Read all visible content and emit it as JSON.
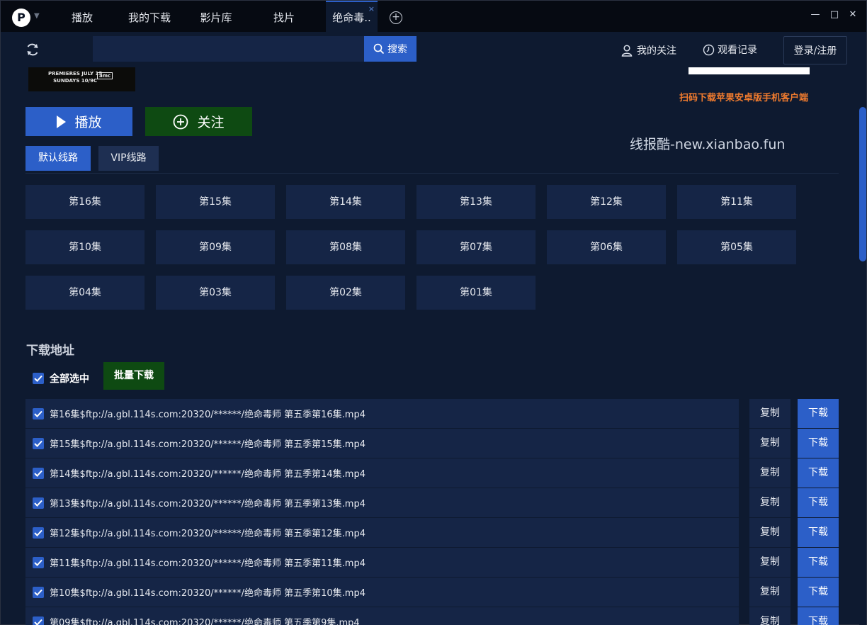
{
  "titlebar": {
    "logo_letter": "P",
    "tabs": [
      {
        "label": "播放"
      },
      {
        "label": "我的下载"
      },
      {
        "label": "影片库"
      },
      {
        "label": "找片"
      },
      {
        "label": "绝命毒.."
      }
    ],
    "add_tab": "+",
    "close_tab": "×",
    "window_controls": {
      "close": "✕",
      "maximize": "□",
      "minimize": "—"
    }
  },
  "toolbar": {
    "search_placeholder": "",
    "search_label": "搜索",
    "follow_label": "我的关注",
    "history_label": "观看记录",
    "login_label": "登录/注册"
  },
  "detail": {
    "poster_line1": "PREMIERES JULY 15",
    "poster_line2": "SUNDAYS 10/9C",
    "poster_brand": "amc",
    "qr_caption": "扫码下载苹果安卓版手机客户端",
    "watermark": "线报酷-new.xianbao.fun",
    "play_label": "播放",
    "follow_label": "关注",
    "routes": [
      {
        "label": "默认线路",
        "active": true
      },
      {
        "label": "VIP线路",
        "active": false
      }
    ],
    "episodes": [
      "第16集",
      "第15集",
      "第14集",
      "第13集",
      "第12集",
      "第11集",
      "第10集",
      "第09集",
      "第08集",
      "第07集",
      "第06集",
      "第05集",
      "第04集",
      "第03集",
      "第02集",
      "第01集"
    ]
  },
  "downloads": {
    "title": "下载地址",
    "select_all_label": "全部选中",
    "batch_label": "批量下载",
    "copy_label": "复制",
    "download_label": "下载",
    "rows": [
      "第16集$ftp://a.gbl.114s.com:20320/******/绝命毒师 第五季第16集.mp4",
      "第15集$ftp://a.gbl.114s.com:20320/******/绝命毒师 第五季第15集.mp4",
      "第14集$ftp://a.gbl.114s.com:20320/******/绝命毒师 第五季第14集.mp4",
      "第13集$ftp://a.gbl.114s.com:20320/******/绝命毒师 第五季第13集.mp4",
      "第12集$ftp://a.gbl.114s.com:20320/******/绝命毒师 第五季第12集.mp4",
      "第11集$ftp://a.gbl.114s.com:20320/******/绝命毒师 第五季第11集.mp4",
      "第10集$ftp://a.gbl.114s.com:20320/******/绝命毒师 第五季第10集.mp4",
      "第09集$ftp://a.gbl.114s.com:20320/******/绝命毒师 第五季第9集.mp4"
    ]
  },
  "colors": {
    "accent": "#2c5fc8",
    "green": "#0e4a12",
    "background": "#0e1a30",
    "orange": "#f07b2e"
  }
}
